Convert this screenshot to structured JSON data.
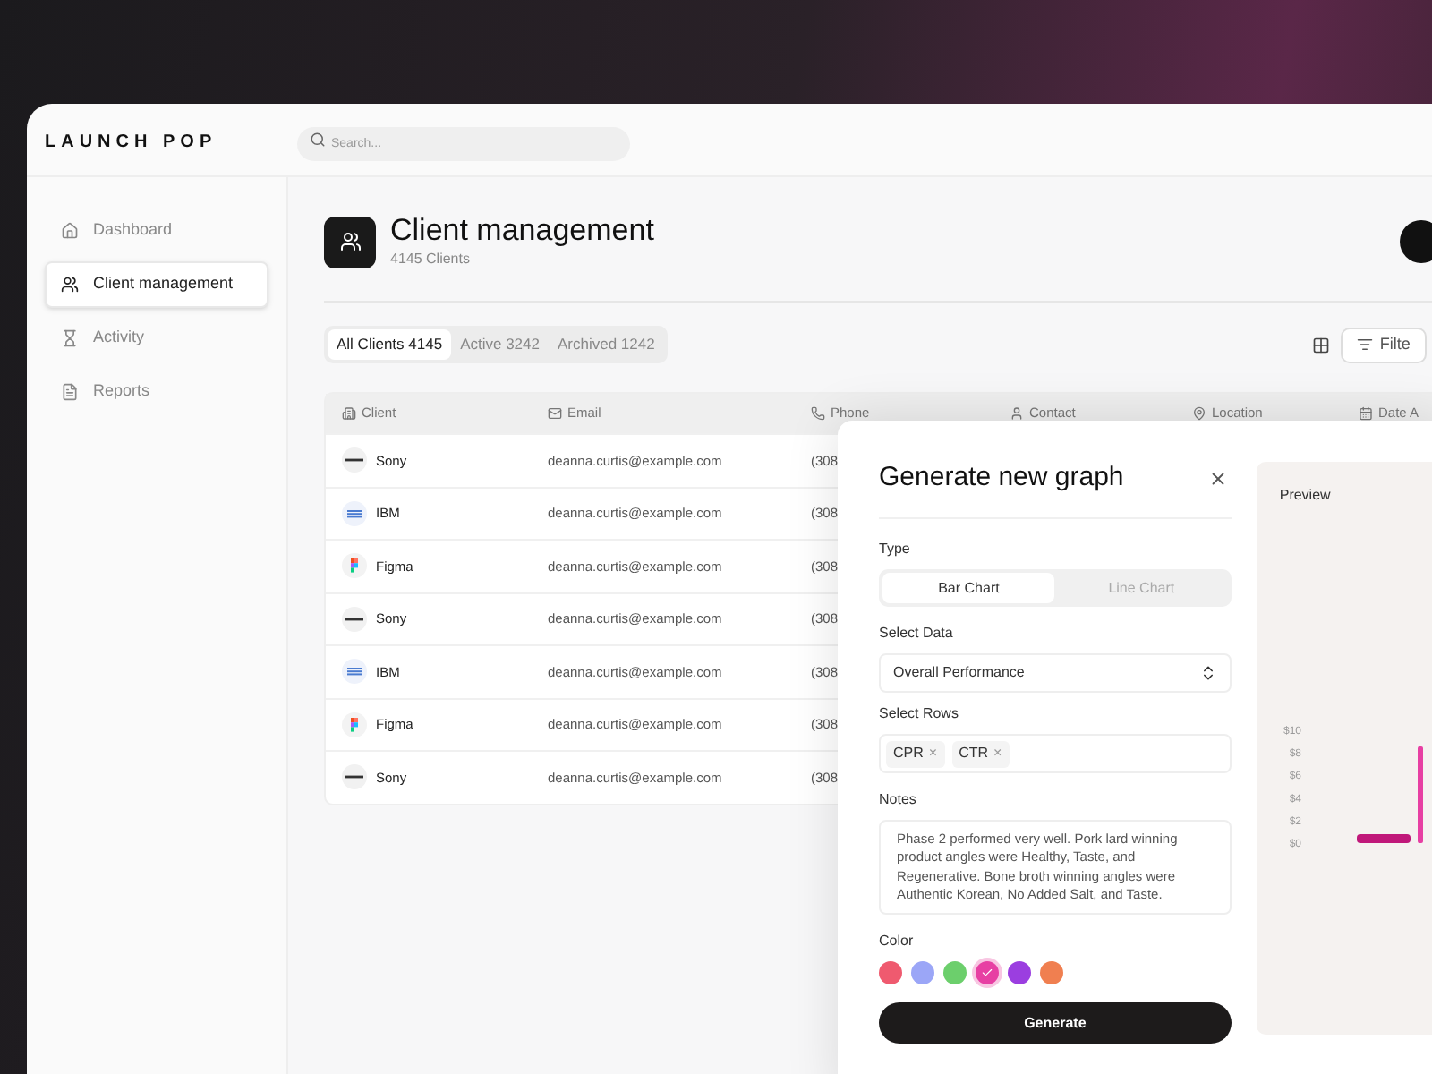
{
  "brand": "LAUNCH POP",
  "search": {
    "placeholder": "Search..."
  },
  "sidebar": {
    "items": [
      {
        "label": "Dashboard",
        "selected": false
      },
      {
        "label": "Client management",
        "selected": true
      },
      {
        "label": "Activity",
        "selected": false
      },
      {
        "label": "Reports",
        "selected": false
      }
    ]
  },
  "header": {
    "title": "Client management",
    "subtitle": "4145 Clients"
  },
  "tabs": [
    {
      "label": "All Clients 4145",
      "selected": true
    },
    {
      "label": "Active 3242",
      "selected": false
    },
    {
      "label": "Archived 1242",
      "selected": false
    }
  ],
  "filter_button": "Filte",
  "table": {
    "columns": [
      {
        "label": "Client"
      },
      {
        "label": "Email"
      },
      {
        "label": "Phone"
      },
      {
        "label": "Contact"
      },
      {
        "label": "Location"
      },
      {
        "label": "Date A"
      }
    ],
    "rows": [
      {
        "kind": "sony",
        "client": "Sony",
        "email": "deanna.curtis@example.com",
        "phone": "(308"
      },
      {
        "kind": "ibm",
        "client": "IBM",
        "email": "deanna.curtis@example.com",
        "phone": "(308"
      },
      {
        "kind": "figma",
        "client": "Figma",
        "email": "deanna.curtis@example.com",
        "phone": "(308"
      },
      {
        "kind": "sony",
        "client": "Sony",
        "email": "deanna.curtis@example.com",
        "phone": "(308"
      },
      {
        "kind": "ibm",
        "client": "IBM",
        "email": "deanna.curtis@example.com",
        "phone": "(308"
      },
      {
        "kind": "figma",
        "client": "Figma",
        "email": "deanna.curtis@example.com",
        "phone": "(308"
      },
      {
        "kind": "sony",
        "client": "Sony",
        "email": "deanna.curtis@example.com",
        "phone": "(308"
      }
    ]
  },
  "dialog": {
    "title": "Generate new graph",
    "type_label": "Type",
    "types": [
      {
        "label": "Bar Chart",
        "selected": true
      },
      {
        "label": "Line Chart",
        "selected": false
      }
    ],
    "data_label": "Select Data",
    "data_value": "Overall Performance",
    "rows_label": "Select Rows",
    "row_tags": [
      "CPR",
      "CTR"
    ],
    "tag_remove": "×",
    "notes_label": "Notes",
    "notes": "Phase 2 performed very well. Pork lard winning product angles were Healthy, Taste, and Regenerative. Bone broth winning angles were Authentic Korean, No Added Salt, and Taste.",
    "color_label": "Color",
    "colors": [
      {
        "color": "#ef5a6f",
        "selected": false
      },
      {
        "color": "#9ba6f7",
        "selected": false
      },
      {
        "color": "#6ccf6c",
        "selected": false
      },
      {
        "color": "#e73fa3",
        "selected": true
      },
      {
        "color": "#9b3ee0",
        "selected": false
      },
      {
        "color": "#f07f50",
        "selected": false
      }
    ],
    "generate_button": "Generate",
    "preview": {
      "title": "Preview",
      "axis_labels": [
        "$10",
        "$8",
        "$6",
        "$4",
        "$2",
        "$0"
      ]
    }
  }
}
